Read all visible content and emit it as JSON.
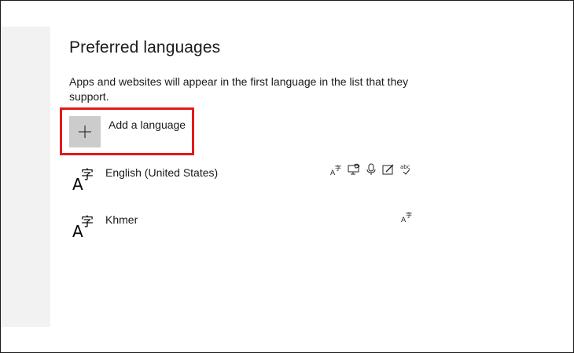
{
  "section": {
    "title": "Preferred languages",
    "description": "Apps and websites will appear in the first language in the list that they support."
  },
  "add_language": {
    "label": "Add a language",
    "icon": "plus-icon"
  },
  "languages": [
    {
      "name": "English (United States)",
      "icon": "language-icon",
      "features": [
        "display-language-icon",
        "text-to-speech-icon",
        "speech-recognition-icon",
        "handwriting-icon",
        "spell-check-icon"
      ]
    },
    {
      "name": "Khmer",
      "icon": "language-icon",
      "features": [
        "display-language-icon"
      ]
    }
  ],
  "colors": {
    "highlight_border": "#e01b1b",
    "add_tile_bg": "#cccccc",
    "sidebar_bg": "#f2f2f2"
  }
}
